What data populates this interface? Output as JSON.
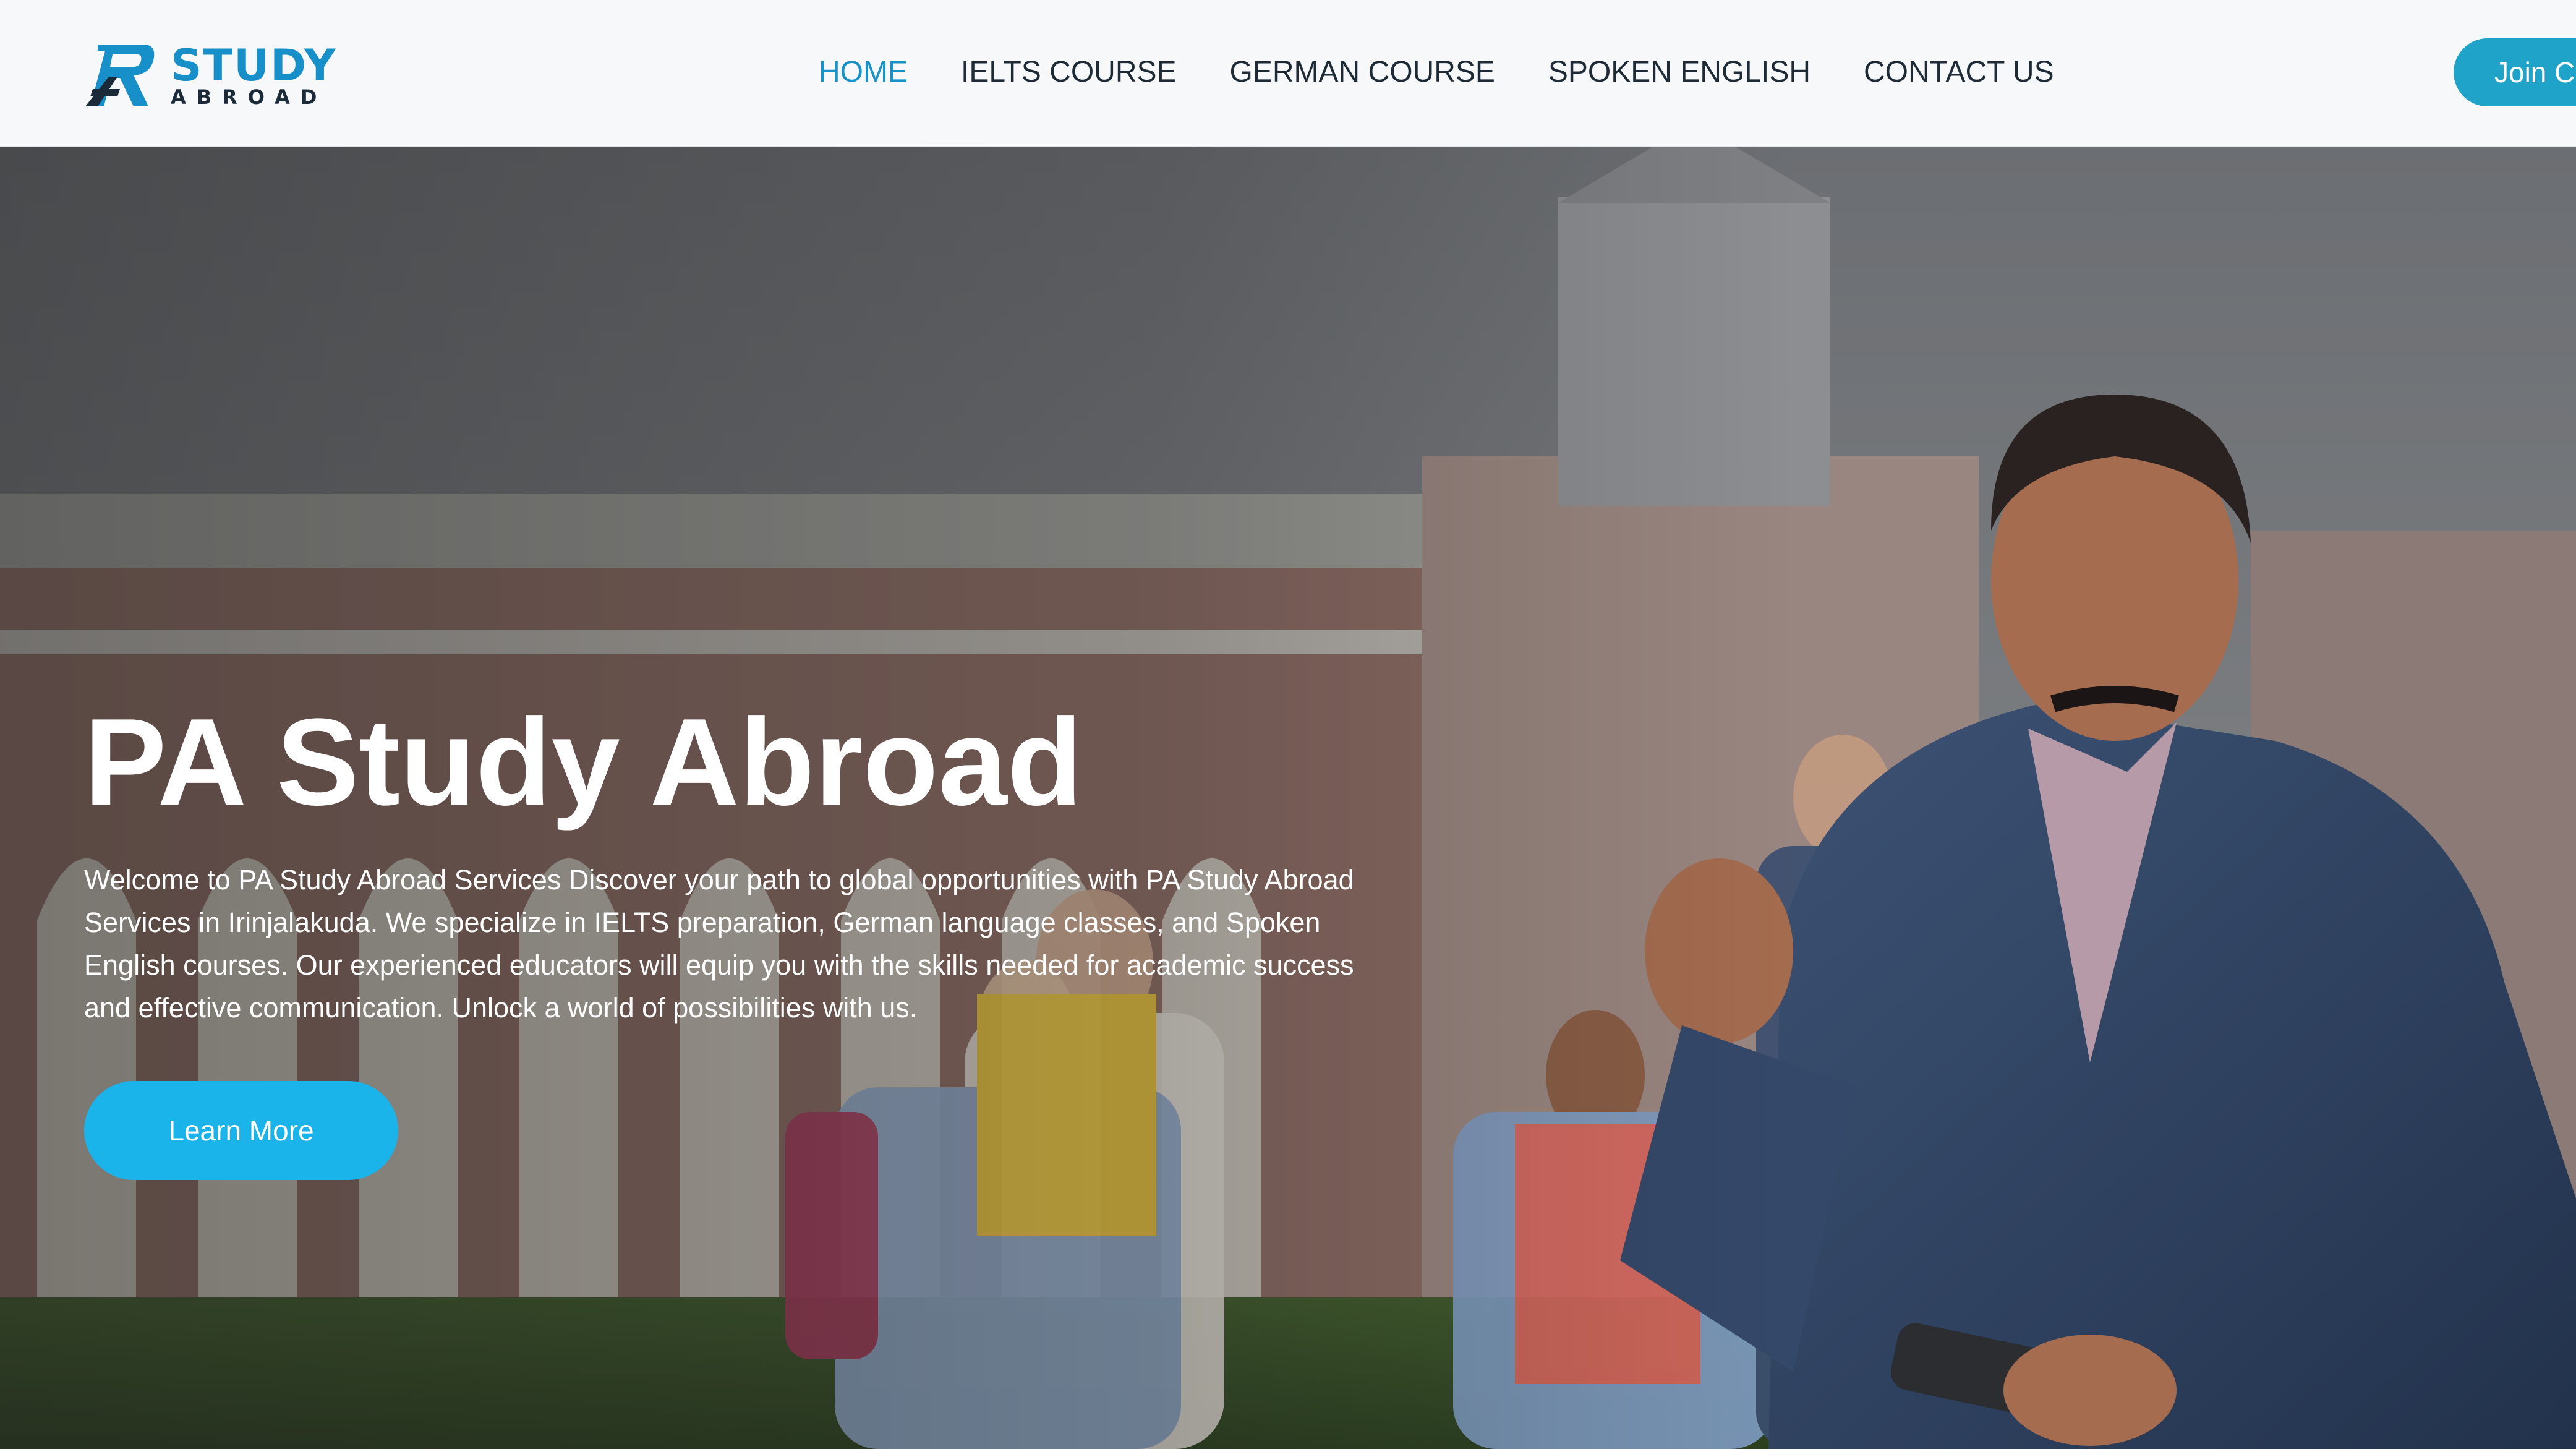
{
  "header": {
    "logo": {
      "word": "STUDY",
      "sub": "ABROAD"
    },
    "nav": [
      {
        "label": "HOME",
        "active": true
      },
      {
        "label": "IELTS COURSE",
        "active": false
      },
      {
        "label": "GERMAN COURSE",
        "active": false
      },
      {
        "label": "SPOKEN ENGLISH",
        "active": false
      },
      {
        "label": "CONTACT US",
        "active": false
      }
    ],
    "join_label": "Join Cl"
  },
  "hero": {
    "title": "PA Study Abroad",
    "description": "Welcome to PA Study Abroad Services Discover your path to global opportunities with PA Study Abroad Services in Irinjalakuda. We specialize in IELTS preparation, German language classes, and Spoken English courses. Our experienced educators will equip you with the skills needed for academic success and effective communication. Unlock a world of possibilities with us.",
    "cta_label": "Learn More"
  },
  "colors": {
    "brand": "#1790c9",
    "nav_active": "#1993c7",
    "nav_text": "#1e2a36",
    "cta": "#1ab3ea",
    "join": "#1fa3c9"
  }
}
